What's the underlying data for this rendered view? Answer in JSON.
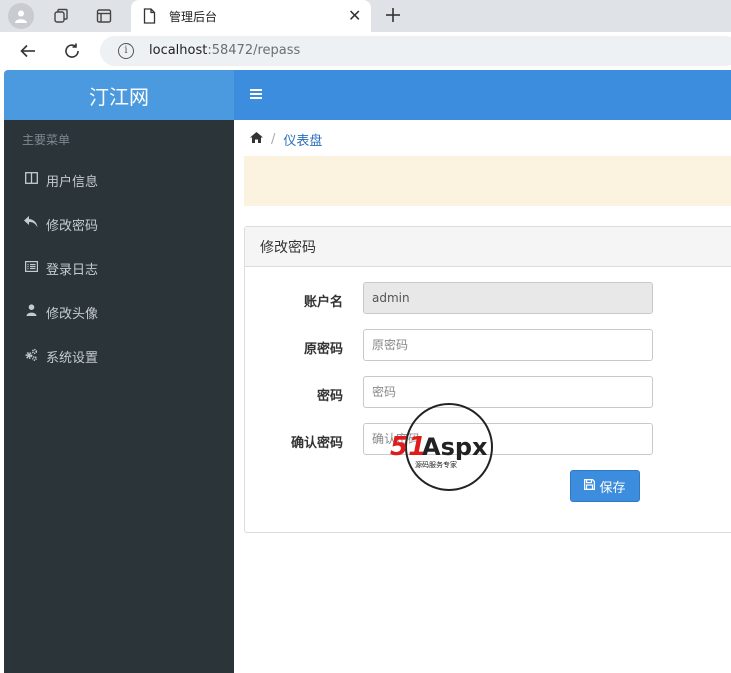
{
  "browser": {
    "tab_title": "管理后台",
    "url_host": "localhost",
    "url_rest": ":58472/repass"
  },
  "app": {
    "brand": "汀江网",
    "menu_header": "主要菜单",
    "menu_items": [
      {
        "label": "用户信息",
        "icon": "columns-icon"
      },
      {
        "label": "修改密码",
        "icon": "reply-icon"
      },
      {
        "label": "登录日志",
        "icon": "list-alt-icon"
      },
      {
        "label": "修改头像",
        "icon": "user-icon"
      },
      {
        "label": "系统设置",
        "icon": "cogs-icon"
      }
    ],
    "breadcrumb": {
      "current": "仪表盘"
    }
  },
  "panel": {
    "title": "修改密码",
    "fields": {
      "account": {
        "label": "账户名",
        "value": "admin"
      },
      "old_password": {
        "label": "原密码",
        "placeholder": "原密码"
      },
      "password": {
        "label": "密码",
        "placeholder": "密码"
      },
      "confirm": {
        "label": "确认密码",
        "placeholder": "确认密码"
      }
    },
    "save_label": "保存"
  },
  "watermark": {
    "text": "51Aspx",
    "subtext": "源码服务专家"
  },
  "colors": {
    "topbar": "#3c8dde",
    "brand": "#4b99df",
    "sidebar": "#2a3439",
    "alert": "#fcf2e0",
    "button": "#3c8dde"
  }
}
